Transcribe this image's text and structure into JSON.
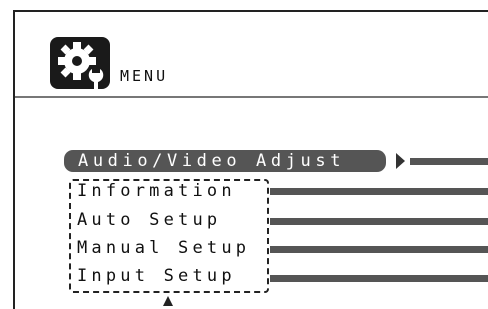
{
  "header": {
    "title": "MENU",
    "icon": "gear-wrench-icon"
  },
  "menu": {
    "selected": "Audio/Video Adjust",
    "items": [
      "Information",
      "Auto Setup",
      "Manual Setup",
      "Input Setup"
    ]
  },
  "colors": {
    "selection_bg": "#555555",
    "text": "#111111",
    "background": "#ffffff"
  }
}
